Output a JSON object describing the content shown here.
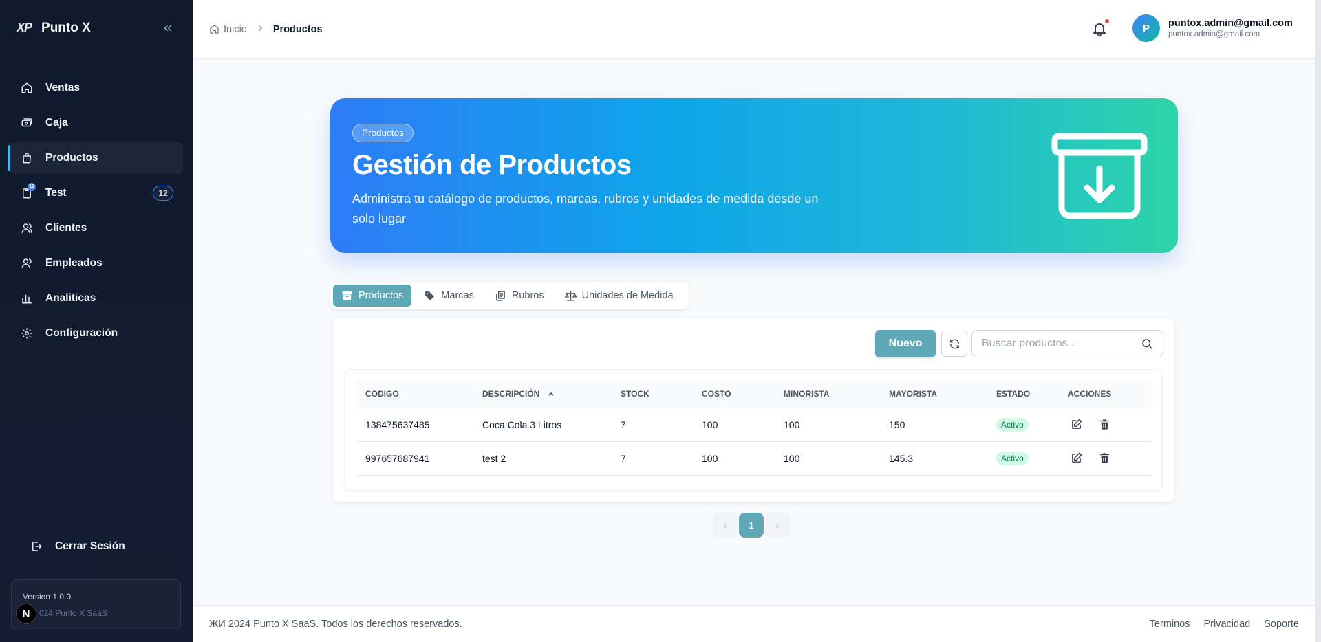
{
  "sidebar": {
    "brand_logo": "XP",
    "brand_name": "Punto X",
    "items": [
      {
        "label": "Ventas",
        "icon": "home-icon"
      },
      {
        "label": "Caja",
        "icon": "cash-register-icon"
      },
      {
        "label": "Productos",
        "icon": "shopping-bag-icon",
        "active": true
      },
      {
        "label": "Test",
        "icon": "clipboard-icon",
        "badge": "12"
      },
      {
        "label": "Clientes",
        "icon": "users-icon"
      },
      {
        "label": "Empleados",
        "icon": "employees-icon"
      },
      {
        "label": "Analiticas",
        "icon": "bar-chart-icon"
      },
      {
        "label": "Configuración",
        "icon": "gear-icon"
      }
    ],
    "logout_label": "Cerrar Sesión",
    "version": "Version 1.0.0",
    "copyright": "024 Punto X SaaS",
    "n_badge": "N"
  },
  "header": {
    "breadcrumb_home": "Inicio",
    "breadcrumb_current": "Productos",
    "user_initial": "P",
    "user_name": "puntox.admin@gmail.com",
    "user_email": "puntox.admin@gmail.com"
  },
  "hero": {
    "tag": "Productos",
    "title": "Gestión de Productos",
    "subtitle": "Administra tu catálogo de productos, marcas, rubros y unidades de medida desde un solo lugar"
  },
  "tabs": [
    {
      "label": "Productos",
      "icon": "archive-box-icon",
      "active": true
    },
    {
      "label": "Marcas",
      "icon": "tag-icon"
    },
    {
      "label": "Rubros",
      "icon": "documents-icon"
    },
    {
      "label": "Unidades de Medida",
      "icon": "scale-icon"
    }
  ],
  "toolbar": {
    "new_label": "Nuevo",
    "search_placeholder": "Buscar productos..."
  },
  "table": {
    "columns": [
      "CODIGO",
      "DESCRIPCIÓN",
      "STOCK",
      "COSTO",
      "MINORISTA",
      "MAYORISTA",
      "ESTADO",
      "ACCIONES"
    ],
    "rows": [
      {
        "codigo": "138475637485",
        "descripcion": "Coca Cola 3 Litros",
        "stock": "7",
        "costo": "100",
        "minorista": "100",
        "mayorista": "150",
        "estado": "Activo"
      },
      {
        "codigo": "997657687941",
        "descripcion": "test 2",
        "stock": "7",
        "costo": "100",
        "minorista": "100",
        "mayorista": "145.3",
        "estado": "Activo"
      }
    ]
  },
  "pagination": {
    "prev": "‹",
    "page": "1",
    "next": "›"
  },
  "footer": {
    "copyright": "ЖИ 2024 Punto X SaaS. Todos los derechos reservados.",
    "links": [
      "Terminos",
      "Privacidad",
      "Soporte"
    ]
  },
  "colors": {
    "sidebar_bg": "#0f1a2e",
    "accent": "#5fa8b8",
    "hero_start": "#2d7cf6",
    "hero_end": "#2dd4a8",
    "status_active": "#047857"
  }
}
